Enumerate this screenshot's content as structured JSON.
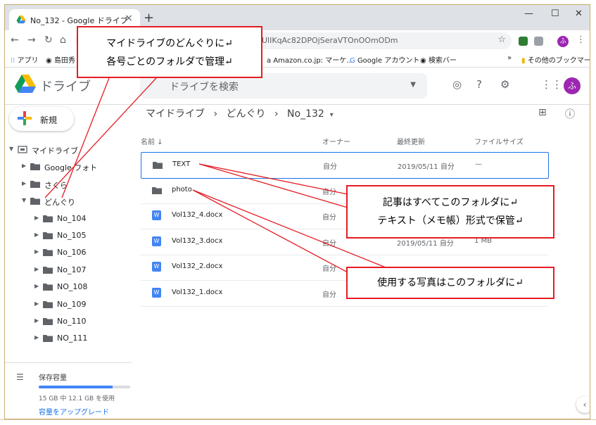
{
  "browser": {
    "tab_title": "No_132 - Google ドライブ",
    "new_tab": "+",
    "url": "UlIKqAc82DPOjSeraVTOnOOmODm",
    "profile_initial": "ふ"
  },
  "bookmarks": [
    {
      "label": "アプリ"
    },
    {
      "label": "島田秀"
    },
    {
      "label": "Amazon.co.jp: マーケ..."
    },
    {
      "label": "Google アカウント"
    },
    {
      "label": "検索バー"
    },
    {
      "label": "»"
    },
    {
      "label": "その他のブックマーク"
    }
  ],
  "drive": {
    "title": "ドライブ",
    "search_placeholder": "ドライブを検索",
    "avatar_initial": "ふ"
  },
  "sidebar": {
    "new_label": "新規",
    "tree": [
      {
        "label": "マイドライブ",
        "depth": 0,
        "expanded": true
      },
      {
        "label": "Google フォト",
        "depth": 1,
        "expanded": false
      },
      {
        "label": "さくら",
        "depth": 1,
        "expanded": false
      },
      {
        "label": "どんぐり",
        "depth": 1,
        "expanded": true
      },
      {
        "label": "No_104",
        "depth": 2,
        "expanded": false
      },
      {
        "label": "No_105",
        "depth": 2,
        "expanded": false
      },
      {
        "label": "No_106",
        "depth": 2,
        "expanded": false
      },
      {
        "label": "No_107",
        "depth": 2,
        "expanded": false
      },
      {
        "label": "NO_108",
        "depth": 2,
        "expanded": false
      },
      {
        "label": "No_109",
        "depth": 2,
        "expanded": false
      },
      {
        "label": "No_110",
        "depth": 2,
        "expanded": false
      },
      {
        "label": "NO_111",
        "depth": 2,
        "expanded": false
      }
    ],
    "storage": {
      "label": "保存容量",
      "usage": "15 GB 中 12.1 GB を使用",
      "fraction_used": 0.81,
      "upgrade": "容量をアップグレード"
    }
  },
  "breadcrumb": {
    "root": "マイドライブ",
    "sep": "›",
    "parent": "どんぐり",
    "current": "No_132",
    "caret": "▾"
  },
  "columns": {
    "name": "名前 ↓",
    "owner": "オーナー",
    "modified": "最終更新",
    "size": "ファイルサイズ"
  },
  "files": [
    {
      "type": "folder",
      "name": "TEXT",
      "owner": "自分",
      "modified": "2019/05/11 自分",
      "size": "—",
      "selected": true
    },
    {
      "type": "folder",
      "name": "photo",
      "owner": "自分",
      "modified": "",
      "size": "",
      "selected": false
    },
    {
      "type": "word",
      "name": "Vol132_4.docx",
      "owner": "自分",
      "modified": "",
      "size": "",
      "selected": false
    },
    {
      "type": "word",
      "name": "Vol132_3.docx",
      "owner": "自分",
      "modified": "2019/05/11 自分",
      "size": "1 MB",
      "selected": false
    },
    {
      "type": "word",
      "name": "Vol132_2.docx",
      "owner": "自分",
      "modified": "",
      "size": "",
      "selected": false
    },
    {
      "type": "word",
      "name": "Vol132_1.docx",
      "owner": "自分",
      "modified": "",
      "size": "",
      "selected": false
    }
  ],
  "callouts": {
    "top_line1": "マイドライブのどんぐりに↵",
    "top_line2": "各号ごとのフォルダで管理↵",
    "text_line1": "記事はすべてこのフォルダに↵",
    "text_line2": "テキスト（メモ帳）形式で保管↵",
    "photo_line1": "使用する写真はこのフォルダに↵"
  },
  "colors": {
    "accent": "#1a73e8",
    "callout_border": "#e51c23",
    "avatar": "#9c27b0"
  }
}
